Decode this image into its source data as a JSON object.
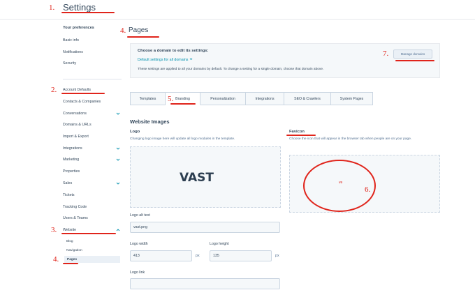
{
  "app": {
    "title": "Settings"
  },
  "sidebar": {
    "prefs_heading": "Your preferences",
    "prefs_items": [
      {
        "label": "Basic info"
      },
      {
        "label": "Notifications"
      },
      {
        "label": "Security"
      }
    ],
    "account_items": [
      {
        "label": "Account Defaults",
        "chevron": false
      },
      {
        "label": "Contacts & Companies",
        "chevron": false
      },
      {
        "label": "Conversations",
        "chevron": true
      },
      {
        "label": "Domains & URLs",
        "chevron": false
      },
      {
        "label": "Import & Export",
        "chevron": false
      },
      {
        "label": "Integrations",
        "chevron": true
      },
      {
        "label": "Marketing",
        "chevron": true
      },
      {
        "label": "Properties",
        "chevron": false
      },
      {
        "label": "Sales",
        "chevron": true
      },
      {
        "label": "Tickets",
        "chevron": false
      },
      {
        "label": "Tracking Code",
        "chevron": false
      },
      {
        "label": "Users & Teams",
        "chevron": false
      },
      {
        "label": "Website",
        "chevron": true
      }
    ],
    "website_sub": [
      {
        "label": "Blog"
      },
      {
        "label": "Navigation"
      },
      {
        "label": "Pages"
      }
    ]
  },
  "main": {
    "title": "Pages",
    "domain": {
      "heading": "Choose a domain to edit its settings:",
      "selected": "Default settings for all domains",
      "note": "These settings are applied to all your domains by default. To change a setting for a single domain, choose that domain above.",
      "manage_label": "Manage domains"
    },
    "tabs": [
      {
        "label": "Templates"
      },
      {
        "label": "Branding"
      },
      {
        "label": "Personalization"
      },
      {
        "label": "Integrations"
      },
      {
        "label": "SEO & Crawlers"
      },
      {
        "label": "System Pages"
      }
    ],
    "section_title": "Website Images",
    "logo": {
      "label": "Logo",
      "help": "Changing logo image here will update all logo modules in the template.",
      "image_text": "VAST",
      "alt_label": "Logo alt text",
      "alt_value": "vast.png",
      "width_label": "Logo width",
      "width_value": "413",
      "height_label": "Logo height",
      "height_value": "135",
      "unit": "px",
      "link_label": "Logo link",
      "link_value": ""
    },
    "favicon": {
      "label": "Favicon",
      "help": "Choose the icon that will appear in the browser tab when people are on your page.",
      "glyph": "ve"
    }
  },
  "annotations": {
    "n1": "1.",
    "n2": "2.",
    "n3": "3.",
    "n4a": "4.",
    "n4b": "4.",
    "n5": "5.",
    "n6": "6.",
    "n7": "7.",
    "color": "#e0241b"
  },
  "colors": {
    "accent": "#0091ae",
    "text": "#33475b",
    "panel": "#f5f8fa"
  }
}
